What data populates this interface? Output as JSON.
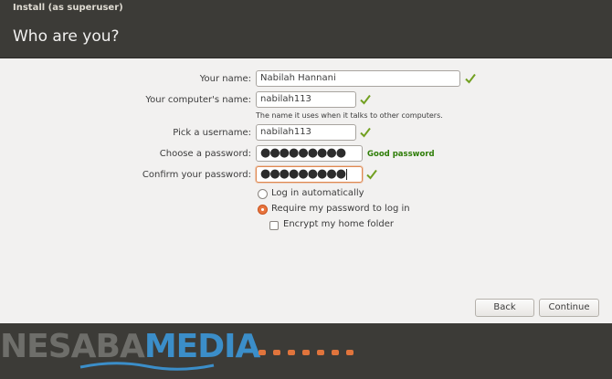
{
  "window": {
    "title": "Install (as superuser)"
  },
  "header": {
    "title": "Who are you?"
  },
  "form": {
    "your_name": {
      "label": "Your name:",
      "value": "Nabilah Hannani"
    },
    "computer_name": {
      "label": "Your computer's name:",
      "value": "nabilah113",
      "hint": "The name it uses when it talks to other computers."
    },
    "username": {
      "label": "Pick a username:",
      "value": "nabilah113"
    },
    "password": {
      "label": "Choose a password:",
      "dots": "●●●●●●●●●",
      "strength": "Good password"
    },
    "confirm": {
      "label": "Confirm your password:",
      "dots": "●●●●●●●●●"
    },
    "options": {
      "login_auto": "Log in automatically",
      "require_password": "Require my password to log in",
      "encrypt_home": "Encrypt my home folder"
    }
  },
  "buttons": {
    "back": "Back",
    "continue": "Continue"
  },
  "footer": {
    "brand_part1": "NESABA",
    "brand_part2": "MEDIA",
    "progress_dots": 7
  },
  "colors": {
    "accent": "#e8743e",
    "check": "#72a021",
    "header_bg": "#3c3b37",
    "good_password": "#2e7d07"
  },
  "icons": {
    "check": "check-icon"
  }
}
